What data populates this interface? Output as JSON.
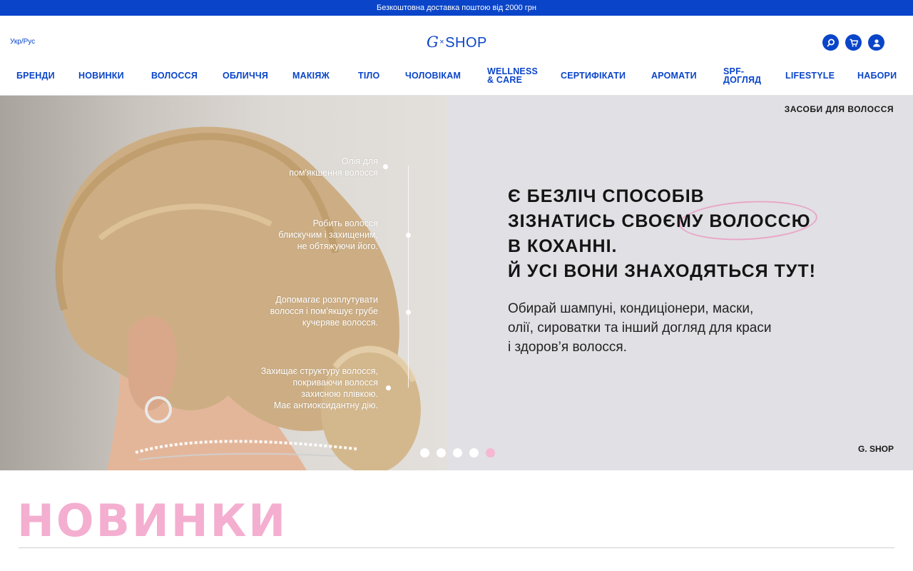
{
  "promo": {
    "text": "Безкоштовна доставка поштою від 2000 грн"
  },
  "header": {
    "language": "Укр/Рус",
    "logo": {
      "g": "G",
      "x": "×",
      "shop": "SHOP"
    },
    "icons": [
      "search-icon",
      "cart-icon",
      "user-icon"
    ]
  },
  "nav": {
    "items": [
      {
        "label": "БРЕНДИ"
      },
      {
        "label": "НОВИНКИ"
      },
      {
        "label": "ВОЛОССЯ"
      },
      {
        "label": "ОБЛИЧЧЯ"
      },
      {
        "label": "МАКІЯЖ"
      },
      {
        "label": "ТІЛО"
      },
      {
        "label": "ЧОЛОВІКАМ"
      },
      {
        "label": "WELLNESS",
        "label2": "& CARE"
      },
      {
        "label": "СЕРТИФІКАТИ"
      },
      {
        "label": "АРОМАТИ"
      },
      {
        "label": "SPF-",
        "label2": "ДОГЛЯД"
      },
      {
        "label": "LIFESTYLE"
      },
      {
        "label": "НАБОРИ"
      }
    ]
  },
  "hero": {
    "tag": "ЗАСОБИ ДЛЯ ВОЛОССЯ",
    "headline": [
      "Є БЕЗЛІЧ СПОСОБІВ",
      "ЗІЗНАТИСЬ СВОЄМУ ВОЛОССЮ",
      "В КОХАННІ.",
      "Й УСІ ВОНИ ЗНАХОДЯТЬСЯ ТУТ!"
    ],
    "text": [
      "Обирай шампуні, кондиціонери, маски,",
      "олії, сироватки та інший догляд для краси",
      "і здоров’я волосся."
    ],
    "brand": "G. SHOP",
    "callouts": [
      {
        "lines": [
          "Олія для",
          "пом'якшення волосся"
        ]
      },
      {
        "lines": [
          "Робить волосся",
          "блискучим і захищеним,",
          "не обтяжуючи його."
        ]
      },
      {
        "lines": [
          "Допомагає розплутувати",
          "волосся і пом'якшує грубе",
          "кучеряве волосся."
        ]
      },
      {
        "lines": [
          "Захищає структуру волосся,",
          "покриваючи волосся",
          "захисною плівкою.",
          "Має антиоксидантну дію."
        ]
      }
    ],
    "slides_total": 5,
    "slide_active": 5,
    "colors": {
      "accent": "#0a45c9",
      "pink": "#f4aed0"
    }
  },
  "section": {
    "title": "НОВИНКИ"
  }
}
